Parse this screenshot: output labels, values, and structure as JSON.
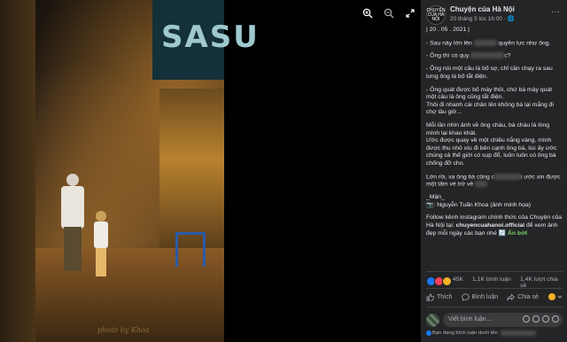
{
  "photo": {
    "shop_sign": "SASU",
    "watermark": "photo by Khoa",
    "tools": [
      {
        "icon": "zoom-in-icon"
      },
      {
        "icon": "zoom-out-icon"
      },
      {
        "icon": "fullscreen-icon"
      }
    ]
  },
  "post": {
    "avatar_text": "CHUYỆN CỦA HÀ NỘI",
    "page_name": "Chuyện của Hà Nội",
    "time": "20 tháng 5 lúc 16:00 · 🌐",
    "date_line": "| 20 . 05 . 2021 |",
    "lines": {
      "l1a": "- Sau này lớn lên",
      "l1b": "quyền lực như ông.",
      "l2a": "- Ông thì có quy",
      "l2b": "c?",
      "l3": "- Ông nói một câu là bố sợ, chỉ cần chạy ra sau lưng ông là bố tắt điện.",
      "l4": "- Ông quát được bố mày thôi, chứ bà mày quát một câu là ông cũng tắt điện.",
      "l5": "Thôi đi nhanh cái chân lên không bà lại mắng đi chợ lâu giờ...",
      "l6": "Mỗi lần nhìn ảnh về ông cháu, bà cháu là lòng mình lại khao khát.",
      "l7": "Ước được quay về một chiều nắng vàng, mình được thu nhỏ xíu đi bên cạnh ông bà, lúc ấy ước chúng cả thế giới có sụp đổ, luôn luôn có ông bà chống đỡ cho.",
      "l8a": "Lớn rồi, xa ông bà cũng c",
      "l8b": "i ước xin được một tấm vé trở về",
      "author": "_Mận_",
      "credit": "📷: Nguyễn Tuấn Khoa (ảnh minh họa)",
      "follow_a": "Follow kênh instagram chính thức của Chuyện của Hà Nội tại: ",
      "follow_handle": "chuyencuahanoi.official",
      "follow_b": " để xem ảnh đẹp mỗi ngày các bạn nhé ",
      "follow_tail": "🔄 Ấn bớt"
    },
    "reactions": {
      "count": "45K",
      "comments": "1,1K bình luận",
      "shares": "1,4K lượt chia sẻ",
      "colors": {
        "like": "#1877f2",
        "love": "#f33e58",
        "haha": "#f7b125"
      }
    },
    "actions": {
      "like": "Thích",
      "comment": "Bình luận",
      "share": "Chia sẻ"
    },
    "comment_placeholder": "Viết bình luận...",
    "notice": "Bạn đang bình luận dưới tên"
  }
}
